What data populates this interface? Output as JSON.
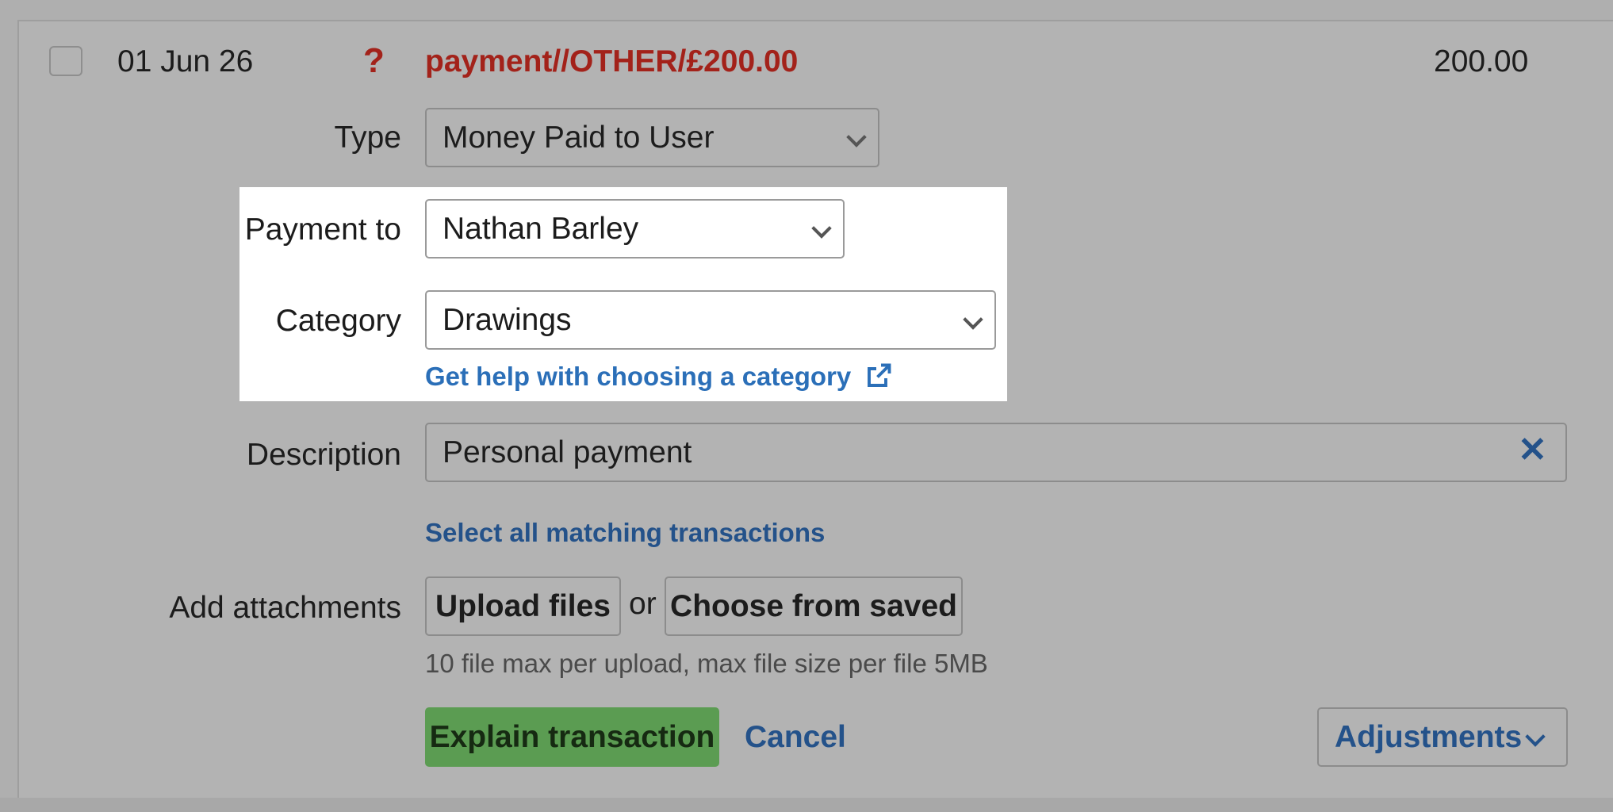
{
  "transaction": {
    "date": "01 Jun 26",
    "status_icon": "?",
    "title": "payment//OTHER/£200.00",
    "amount": "200.00"
  },
  "form": {
    "type_label": "Type",
    "type_value": "Money Paid to User",
    "payment_to_label": "Payment to",
    "payment_to_value": "Nathan Barley",
    "category_label": "Category",
    "category_value": "Drawings",
    "category_help_link": "Get help with choosing a category",
    "description_label": "Description",
    "description_value": "Personal payment",
    "select_matching_link": "Select all matching transactions",
    "attachments_label": "Add attachments",
    "upload_button": "Upload files",
    "or_text": "or",
    "choose_saved_button": "Choose from saved",
    "attachments_hint": "10 file max per upload, max file size per file 5MB"
  },
  "actions": {
    "explain_button": "Explain transaction",
    "cancel_link": "Cancel",
    "adjustments_button": "Adjustments"
  },
  "colors": {
    "error_red": "#a3221a",
    "link_blue": "#2b6fb8",
    "primary_green": "#5b9c52",
    "overlay_gray": "#b3b3b3"
  },
  "icons": {
    "status": "question-mark-icon",
    "external_link": "external-link-icon",
    "clear": "close-icon",
    "dropdown": "chevron-down-icon"
  }
}
